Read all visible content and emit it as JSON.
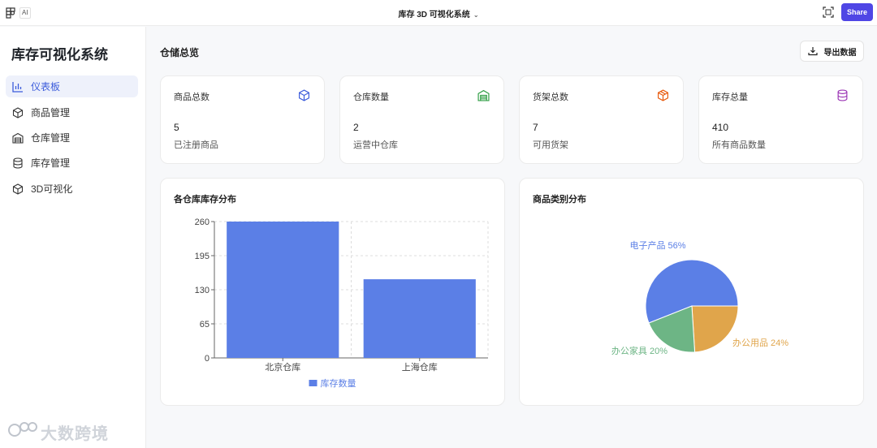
{
  "topbar": {
    "ai_badge": "AI",
    "app_title": "库存 3D 可视化系统",
    "share_label": "Share"
  },
  "sidebar": {
    "title": "库存可视化系统",
    "items": [
      {
        "label": "仪表板",
        "icon": "bar-chart-icon",
        "active": true
      },
      {
        "label": "商品管理",
        "icon": "box-icon",
        "active": false
      },
      {
        "label": "仓库管理",
        "icon": "warehouse-icon",
        "active": false
      },
      {
        "label": "库存管理",
        "icon": "database-icon",
        "active": false
      },
      {
        "label": "3D可视化",
        "icon": "cube-icon",
        "active": false
      }
    ]
  },
  "main": {
    "title": "仓储总览",
    "export_label": "导出数据",
    "stats": [
      {
        "label": "商品总数",
        "value": "5",
        "sub": "已注册商品",
        "icon": "box-icon",
        "color": "#3b5bdb"
      },
      {
        "label": "仓库数量",
        "value": "2",
        "sub": "运营中仓库",
        "icon": "warehouse-icon",
        "color": "#2f9e44"
      },
      {
        "label": "货架总数",
        "value": "7",
        "sub": "可用货架",
        "icon": "package-icon",
        "color": "#e8590c"
      },
      {
        "label": "库存总量",
        "value": "410",
        "sub": "所有商品数量",
        "icon": "database-icon",
        "color": "#9c36b5"
      }
    ],
    "bar_chart_title": "各仓库库存分布",
    "pie_chart_title": "商品类别分布"
  },
  "watermark": "大数跨境",
  "colors": {
    "accent": "#4f46e5",
    "bar": "#5b7fe6",
    "pie": [
      "#5b7fe6",
      "#6db585",
      "#e0a54b"
    ]
  },
  "chart_data": [
    {
      "type": "bar",
      "categories": [
        "北京仓库",
        "上海仓库"
      ],
      "series": [
        {
          "name": "库存数量",
          "values": [
            260,
            150
          ]
        }
      ],
      "yticks": [
        0,
        65,
        130,
        195,
        260
      ],
      "ylim": [
        0,
        260
      ],
      "grid": true,
      "legend": "bottom"
    },
    {
      "type": "pie",
      "slices": [
        {
          "label": "电子产品 56%",
          "value": 56,
          "color": "#5b7fe6"
        },
        {
          "label": "办公用品 24%",
          "value": 24,
          "color": "#e0a54b"
        },
        {
          "label": "办公家具 20%",
          "value": 20,
          "color": "#6db585"
        }
      ]
    }
  ]
}
